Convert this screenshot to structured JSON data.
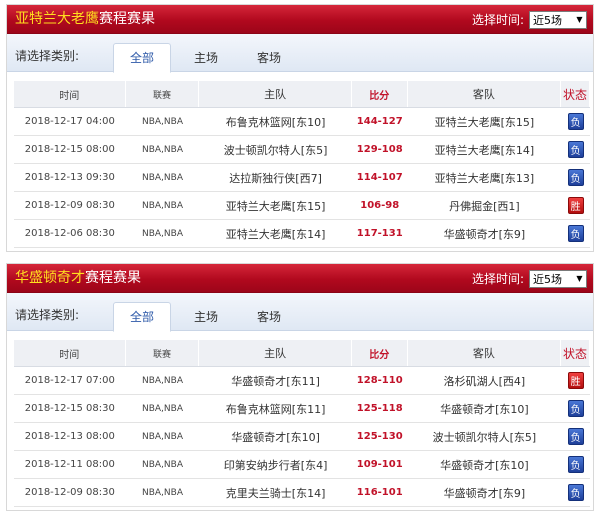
{
  "colors": {
    "header_red": "#b1091e",
    "team_yellow": "#ffde1f",
    "score_red": "#c11229",
    "lose_blue": "#1e3f9a",
    "win_red": "#c41414",
    "tab_blue": "#2d59a8"
  },
  "icons": {
    "dropdown": "triangle-down",
    "result_badge": "square-badge"
  },
  "panels": [
    {
      "team": "亚特兰大老鹰",
      "title_suffix": "赛程赛果",
      "time_label": "选择时间:",
      "time_value": "近5场",
      "category_label": "请选择类别:",
      "tabs": [
        {
          "label": "全部",
          "active": true
        },
        {
          "label": "主场",
          "active": false
        },
        {
          "label": "客场",
          "active": false
        }
      ],
      "columns": [
        "时间",
        "联赛",
        "主队",
        "比分",
        "客队",
        "状态"
      ],
      "rows": [
        {
          "time": "2018-12-17 04:00",
          "league": "NBA,NBA",
          "home": "布鲁克林篮网[东10]",
          "score": "144-127",
          "away": "亚特兰大老鹰[东15]",
          "status": "负",
          "win": false
        },
        {
          "time": "2018-12-15 08:00",
          "league": "NBA,NBA",
          "home": "波士顿凯尔特人[东5]",
          "score": "129-108",
          "away": "亚特兰大老鹰[东14]",
          "status": "负",
          "win": false
        },
        {
          "time": "2018-12-13 09:30",
          "league": "NBA,NBA",
          "home": "达拉斯独行侠[西7]",
          "score": "114-107",
          "away": "亚特兰大老鹰[东13]",
          "status": "负",
          "win": false
        },
        {
          "time": "2018-12-09 08:30",
          "league": "NBA,NBA",
          "home": "亚特兰大老鹰[东15]",
          "score": "106-98",
          "away": "丹佛掘金[西1]",
          "status": "胜",
          "win": true
        },
        {
          "time": "2018-12-06 08:30",
          "league": "NBA,NBA",
          "home": "亚特兰大老鹰[东14]",
          "score": "117-131",
          "away": "华盛顿奇才[东9]",
          "status": "负",
          "win": false
        }
      ]
    },
    {
      "team": "华盛顿奇才",
      "title_suffix": "赛程赛果",
      "time_label": "选择时间:",
      "time_value": "近5场",
      "category_label": "请选择类别:",
      "tabs": [
        {
          "label": "全部",
          "active": true
        },
        {
          "label": "主场",
          "active": false
        },
        {
          "label": "客场",
          "active": false
        }
      ],
      "columns": [
        "时间",
        "联赛",
        "主队",
        "比分",
        "客队",
        "状态"
      ],
      "rows": [
        {
          "time": "2018-12-17 07:00",
          "league": "NBA,NBA",
          "home": "华盛顿奇才[东11]",
          "score": "128-110",
          "away": "洛杉矶湖人[西4]",
          "status": "胜",
          "win": true
        },
        {
          "time": "2018-12-15 08:30",
          "league": "NBA,NBA",
          "home": "布鲁克林篮网[东11]",
          "score": "125-118",
          "away": "华盛顿奇才[东10]",
          "status": "负",
          "win": false
        },
        {
          "time": "2018-12-13 08:00",
          "league": "NBA,NBA",
          "home": "华盛顿奇才[东10]",
          "score": "125-130",
          "away": "波士顿凯尔特人[东5]",
          "status": "负",
          "win": false
        },
        {
          "time": "2018-12-11 08:00",
          "league": "NBA,NBA",
          "home": "印第安纳步行者[东4]",
          "score": "109-101",
          "away": "华盛顿奇才[东10]",
          "status": "负",
          "win": false
        },
        {
          "time": "2018-12-09 08:30",
          "league": "NBA,NBA",
          "home": "克里夫兰骑士[东14]",
          "score": "116-101",
          "away": "华盛顿奇才[东9]",
          "status": "负",
          "win": false
        }
      ]
    }
  ]
}
